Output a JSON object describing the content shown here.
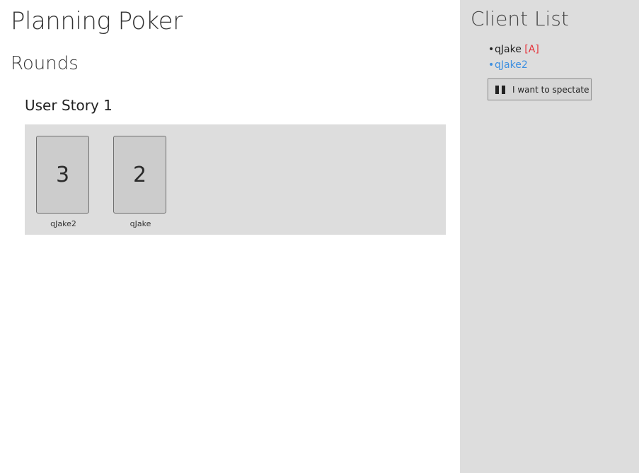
{
  "app": {
    "title": "Planning Poker"
  },
  "rounds": {
    "heading": "Rounds",
    "stories": [
      {
        "title": "User Story 1",
        "cards": [
          {
            "value": "3",
            "owner": "qJake2"
          },
          {
            "value": "2",
            "owner": "qJake"
          }
        ]
      }
    ]
  },
  "sidebar": {
    "title": "Client List",
    "clients": [
      {
        "bullet": "•",
        "name": "qJake",
        "tag": "[A]",
        "is_self": false
      },
      {
        "bullet": "•",
        "name": "qJake2",
        "tag": "",
        "is_self": true
      }
    ],
    "spectate_label": "I want to spectate",
    "spectate_icon": "pause-icon"
  },
  "colors": {
    "self_client": "#3d8fe0",
    "admin_tag": "#e5323a",
    "panel_background": "#dddddd",
    "card_background": "#cccccc"
  }
}
